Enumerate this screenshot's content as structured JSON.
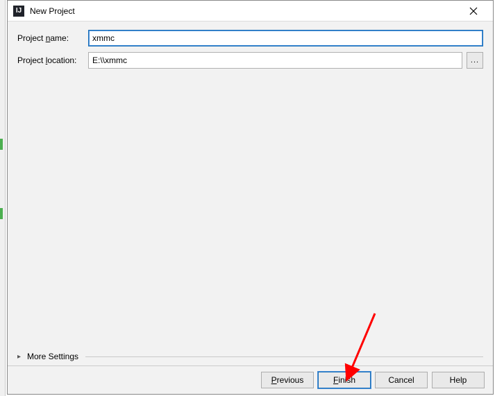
{
  "window": {
    "title": "New Project",
    "appIconLetter": "IJ"
  },
  "form": {
    "projectName": {
      "label_pre": "Project ",
      "label_mnem": "n",
      "label_post": "ame:",
      "value": "xmmc"
    },
    "projectLocation": {
      "label_pre": "Project ",
      "label_mnem": "l",
      "label_post": "ocation:",
      "value": "E:\\\\xmmc"
    },
    "browseLabel": "..."
  },
  "moreSettings": {
    "label": "More Settings"
  },
  "buttons": {
    "previous_mnem": "P",
    "previous_post": "revious",
    "finish_mnem": "F",
    "finish_post": "inish",
    "cancel": "Cancel",
    "help": "Help"
  }
}
